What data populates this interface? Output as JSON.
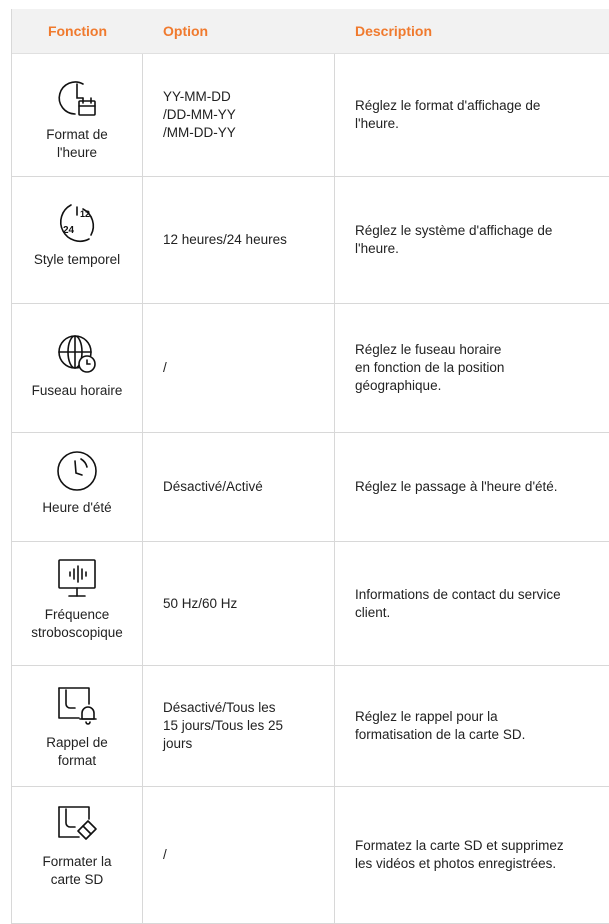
{
  "header": {
    "col1": "Fonction",
    "col2": "Option",
    "col3": "Description"
  },
  "rows": [
    {
      "icon": "clock-calendar-icon",
      "name": "Format de\nl'heure",
      "option": "YY-MM-DD\n/DD-MM-YY\n/MM-DD-YY",
      "description": "Réglez le format d'affichage de\nl'heure."
    },
    {
      "icon": "24h-12h-clock-icon",
      "name": "Style temporel",
      "option": "12 heures/24 heures",
      "description": "Réglez le système d'affichage de\nl'heure."
    },
    {
      "icon": "globe-clock-icon",
      "name": "Fuseau horaire",
      "option": "/",
      "description": "Réglez le fuseau horaire\nen fonction de la position\ngéographique."
    },
    {
      "icon": "daylight-clock-icon",
      "name": "Heure d'été",
      "option": "Désactivé/Activé",
      "description": "Réglez le passage à l'heure d'été."
    },
    {
      "icon": "monitor-waveform-icon",
      "name": "Fréquence\nstroboscopique",
      "option": "50 Hz/60 Hz",
      "description": "Informations de contact du service\nclient."
    },
    {
      "icon": "sd-card-bell-icon",
      "name": "Rappel de\nformat",
      "option": "Désactivé/Tous les\n15 jours/Tous les 25\njours",
      "description": "Réglez le rappel pour la\nformatisation de la carte SD."
    },
    {
      "icon": "sd-card-eraser-icon",
      "name": "Formater la\ncarte SD",
      "option": "/",
      "description": "Formatez la carte SD et supprimez\nles vidéos et photos enregistrées."
    }
  ]
}
